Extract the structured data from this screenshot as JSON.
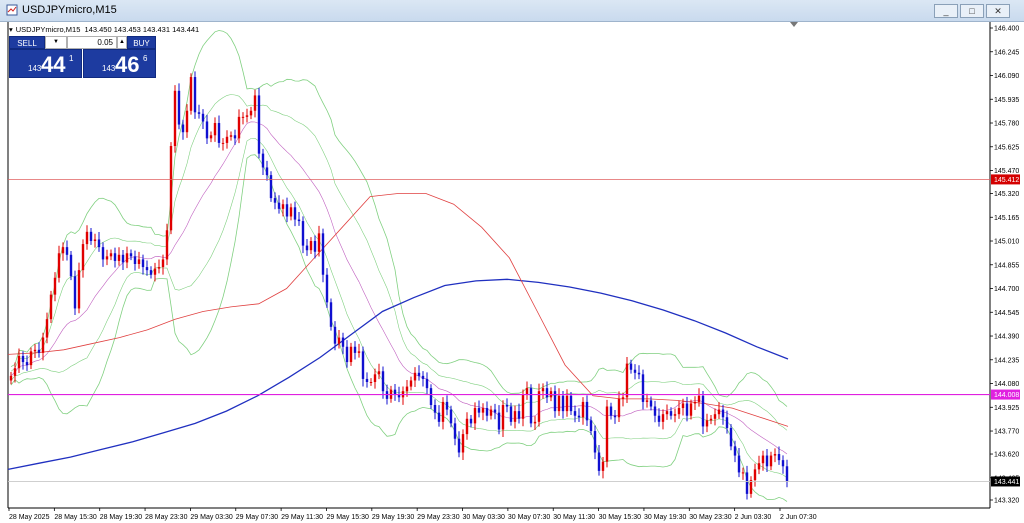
{
  "window": {
    "title": "USDJPYmicro,M15",
    "buttons": [
      "_",
      "□",
      "✕"
    ]
  },
  "header": {
    "symbol_line": "USDJPYmicro,M15  143.450 143.453 143.431 143.441"
  },
  "one_click_trading": {
    "sell_label": "SELL",
    "buy_label": "BUY",
    "lot_value": "0.05",
    "sell_price_small": "143",
    "sell_price_big": "44",
    "sell_price_sup": "1",
    "buy_price_small": "143",
    "buy_price_big": "46",
    "buy_price_sup": "6"
  },
  "price_axis": {
    "ticks": [
      "146.400",
      "146.245",
      "146.090",
      "145.935",
      "145.780",
      "145.625",
      "145.470",
      "145.320",
      "145.165",
      "145.010",
      "144.855",
      "144.700",
      "144.545",
      "144.390",
      "144.235",
      "144.080",
      "143.925",
      "143.770",
      "143.620",
      "143.465",
      "143.320"
    ],
    "markers": [
      {
        "label": "145.412",
        "color": "#d40000"
      },
      {
        "label": "144.008",
        "color": "#e020e0"
      },
      {
        "label": "143.441",
        "color": "#000000"
      }
    ]
  },
  "time_axis": {
    "ticks": [
      "28 May 2025",
      "28 May 15:30",
      "28 May 19:30",
      "28 May 23:30",
      "29 May 03:30",
      "29 May 07:30",
      "29 May 11:30",
      "29 May 15:30",
      "29 May 19:30",
      "29 May 23:30",
      "30 May 03:30",
      "30 May 07:30",
      "30 May 11:30",
      "30 May 15:30",
      "30 May 19:30",
      "30 May 23:30",
      "2 Jun 03:30",
      "2 Jun 07:30"
    ]
  },
  "colors": {
    "bull": "#e00000",
    "bear": "#1010d0",
    "ma_long": "#2030c0",
    "ma_mid": "#e04040",
    "bands": "#80d080",
    "hline_red": "#e06060",
    "hline_magenta": "#e020e0"
  },
  "chart_data": {
    "type": "candlestick",
    "symbol": "USDJPYmicro",
    "timeframe": "M15",
    "ylim": [
      143.3,
      146.45
    ],
    "horizontal_lines": [
      145.412,
      144.008,
      143.441
    ],
    "closes": [
      144.13,
      144.18,
      144.26,
      144.22,
      144.2,
      144.29,
      144.3,
      144.28,
      144.38,
      144.5,
      144.66,
      144.77,
      144.93,
      144.97,
      144.92,
      144.78,
      144.57,
      144.82,
      144.99,
      145.07,
      145.01,
      145.02,
      144.97,
      144.89,
      144.91,
      144.93,
      144.88,
      144.92,
      144.87,
      144.93,
      144.91,
      144.86,
      144.89,
      144.84,
      144.82,
      144.79,
      144.83,
      144.84,
      144.89,
      145.08,
      145.63,
      145.99,
      145.77,
      145.72,
      145.86,
      146.08,
      145.85,
      145.84,
      145.79,
      145.68,
      145.7,
      145.78,
      145.65,
      145.65,
      145.69,
      145.7,
      145.68,
      145.82,
      145.82,
      145.83,
      145.86,
      145.96,
      145.58,
      145.49,
      145.44,
      145.29,
      145.26,
      145.22,
      145.25,
      145.17,
      145.23,
      145.15,
      145.14,
      144.98,
      144.95,
      145.01,
      144.94,
      145.06,
      144.79,
      144.61,
      144.45,
      144.34,
      144.38,
      144.32,
      144.22,
      144.32,
      144.28,
      144.29,
      144.11,
      144.09,
      144.09,
      144.14,
      144.16,
      144.03,
      143.98,
      144.04,
      144.01,
      143.99,
      144.03,
      144.06,
      144.1,
      144.15,
      144.13,
      144.11,
      144.05,
      143.94,
      143.89,
      143.83,
      143.96,
      143.91,
      143.82,
      143.72,
      143.63,
      143.75,
      143.85,
      143.82,
      143.92,
      143.89,
      143.92,
      143.87,
      143.91,
      143.89,
      143.78,
      143.94,
      143.93,
      143.83,
      143.9,
      143.85,
      144.01,
      144.05,
      143.82,
      143.83,
      144.03,
      144.05,
      143.99,
      144.03,
      143.9,
      144.0,
      143.9,
      144.0,
      143.9,
      143.87,
      143.86,
      143.96,
      143.84,
      143.77,
      143.63,
      143.51,
      143.57,
      143.93,
      143.87,
      143.86,
      143.98,
      143.99,
      144.21,
      144.17,
      144.15,
      144.14,
      143.96,
      143.97,
      143.93,
      143.87,
      143.83,
      143.88,
      143.9,
      143.87,
      143.88,
      143.92,
      143.95,
      143.87,
      143.95,
      143.96,
      144.0,
      143.8,
      143.84,
      143.85,
      143.88,
      143.91,
      143.86,
      143.79,
      143.67,
      143.61,
      143.5,
      143.5,
      143.36,
      143.45,
      143.52,
      143.56,
      143.61,
      143.54,
      143.61,
      143.62,
      143.58,
      143.54,
      143.44
    ],
    "series": [
      {
        "name": "MA long",
        "values": [
          143.52,
          143.56,
          143.6,
          143.65,
          143.7,
          143.76,
          143.82,
          143.9,
          144.0,
          144.12,
          144.25,
          144.4,
          144.55,
          144.64,
          144.72,
          144.75,
          144.76,
          144.74,
          144.71,
          144.67,
          144.62,
          144.56,
          144.49,
          144.41,
          144.32,
          144.24
        ]
      },
      {
        "name": "MA mid",
        "values": [
          144.27,
          144.28,
          144.3,
          144.34,
          144.38,
          144.43,
          144.5,
          144.55,
          144.58,
          144.6,
          144.7,
          144.9,
          145.1,
          145.3,
          145.32,
          145.32,
          145.25,
          145.1,
          144.9,
          144.55,
          144.2,
          144.0,
          143.98,
          143.98,
          143.97,
          143.95,
          143.92,
          143.86,
          143.8
        ]
      }
    ]
  }
}
